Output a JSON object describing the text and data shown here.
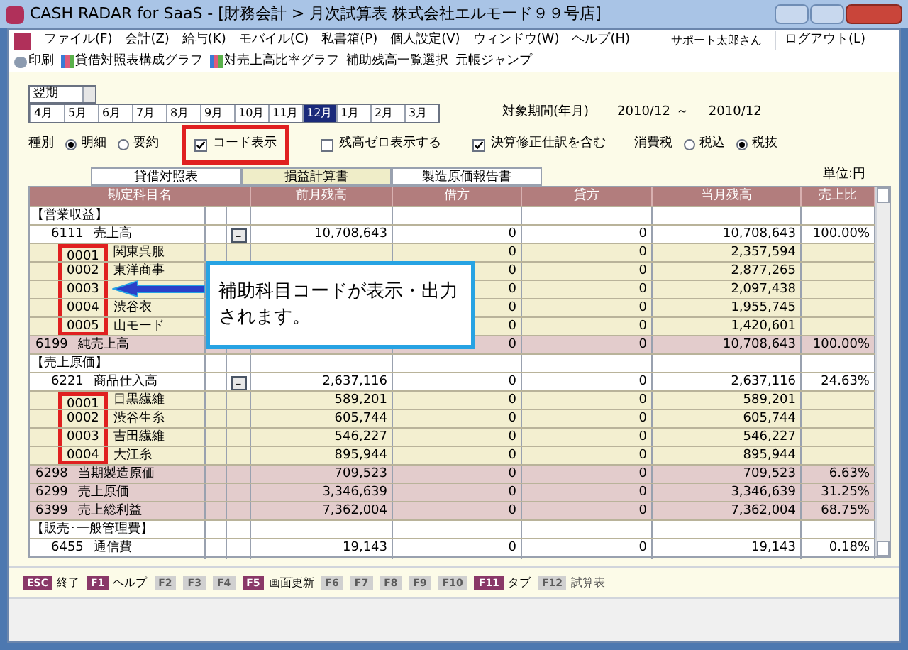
{
  "window": {
    "title": "CASH RADAR for SaaS - [財務会計 > 月次試算表 株式会社エルモード９９号店]"
  },
  "menu": [
    "ファイル(F)",
    "会計(Z)",
    "給与(K)",
    "モバイル(C)",
    "私書箱(P)",
    "個人設定(V)",
    "ウィンドウ(W)",
    "ヘルプ(H)"
  ],
  "user": "サポート太郎さん",
  "logout": "ログアウト(L)",
  "toolbar": [
    {
      "label": "印刷",
      "kind": "print"
    },
    {
      "label": "貸借対照表構成グラフ",
      "kind": "chart"
    },
    {
      "label": "対売上高比率グラフ",
      "kind": "chart"
    },
    {
      "label": "補助残高一覧選択",
      "kind": "text"
    },
    {
      "label": "元帳ジャンプ",
      "kind": "text"
    }
  ],
  "period_select": "翌期",
  "months": [
    {
      "label": "4月",
      "selected": false
    },
    {
      "label": "5月",
      "selected": false
    },
    {
      "label": "6月",
      "selected": false
    },
    {
      "label": "7月",
      "selected": false
    },
    {
      "label": "8月",
      "selected": false
    },
    {
      "label": "9月",
      "selected": false
    },
    {
      "label": "10月",
      "selected": false
    },
    {
      "label": "11月",
      "selected": false
    },
    {
      "label": "12月",
      "selected": true
    },
    {
      "label": "1月",
      "selected": false
    },
    {
      "label": "2月",
      "selected": false
    },
    {
      "label": "3月",
      "selected": false
    }
  ],
  "period_label": "対象期間(年月)",
  "period_from": "2010/12",
  "period_sep": "～",
  "period_to": "2010/12",
  "type_label": "種別",
  "type_options": [
    {
      "label": "明細",
      "selected": true
    },
    {
      "label": "要約",
      "selected": false
    }
  ],
  "checks": [
    {
      "label": "コード表示",
      "checked": true,
      "highlighted": true
    },
    {
      "label": "残高ゼロ表示する",
      "checked": false,
      "highlighted": false
    },
    {
      "label": "決算修正仕訳を含む",
      "checked": true,
      "highlighted": false
    }
  ],
  "tax_label": "消費税",
  "tax_options": [
    {
      "label": "税込",
      "selected": false
    },
    {
      "label": "税抜",
      "selected": true
    }
  ],
  "tabs": [
    {
      "label": "貸借対照表",
      "selected": false
    },
    {
      "label": "損益計算書",
      "selected": true
    },
    {
      "label": "製造原価報告書",
      "selected": false
    }
  ],
  "unit": "単位:円",
  "columns": [
    "勘定科目名",
    "前月残高",
    "借方",
    "貸方",
    "当月残高",
    "売上比"
  ],
  "rows": [
    {
      "kind": "section",
      "name": "【営業収益】"
    },
    {
      "kind": "account",
      "code": "6111",
      "name": "売上高",
      "expand": "－",
      "prior": "10,708,643",
      "debit": "0",
      "credit": "0",
      "current": "10,708,643",
      "ratio": "100.00%"
    },
    {
      "kind": "sub",
      "code": "0001",
      "name": "関東呉服",
      "debit": "0",
      "credit": "0",
      "current": "2,357,594",
      "highlighted": true
    },
    {
      "kind": "sub",
      "code": "0002",
      "name": "東洋商事",
      "debit": "0",
      "credit": "0",
      "current": "2,877,265",
      "highlighted": true
    },
    {
      "kind": "sub",
      "code": "0003",
      "debit": "0",
      "credit": "0",
      "current": "2,097,438",
      "highlighted": true
    },
    {
      "kind": "sub",
      "code": "0004",
      "name": "渋谷衣",
      "debit": "0",
      "credit": "0",
      "current": "1,955,745",
      "highlighted": true
    },
    {
      "kind": "sub",
      "code": "0005",
      "name": "山モード",
      "debit": "0",
      "credit": "0",
      "current": "1,420,601",
      "highlighted": true
    },
    {
      "kind": "total",
      "code": "6199",
      "name": "純売上高",
      "debit": "0",
      "credit": "0",
      "current": "10,708,643",
      "ratio": "100.00%"
    },
    {
      "kind": "section",
      "name": "【売上原価】"
    },
    {
      "kind": "account",
      "code": "6221",
      "name": "商品仕入高",
      "expand": "－",
      "prior": "2,637,116",
      "debit": "0",
      "credit": "0",
      "current": "2,637,116",
      "ratio": "24.63%"
    },
    {
      "kind": "sub",
      "code": "0001",
      "name": "目黒繊維",
      "prior": "589,201",
      "debit": "0",
      "credit": "0",
      "current": "589,201",
      "highlighted": true
    },
    {
      "kind": "sub",
      "code": "0002",
      "name": "渋谷生糸",
      "prior": "605,744",
      "debit": "0",
      "credit": "0",
      "current": "605,744",
      "highlighted": true
    },
    {
      "kind": "sub",
      "code": "0003",
      "name": "吉田繊維",
      "prior": "546,227",
      "debit": "0",
      "credit": "0",
      "current": "546,227",
      "highlighted": true
    },
    {
      "kind": "sub",
      "code": "0004",
      "name": "大江糸",
      "prior": "895,944",
      "debit": "0",
      "credit": "0",
      "current": "895,944",
      "highlighted": true
    },
    {
      "kind": "total",
      "code": "6298",
      "name": "当期製造原価",
      "prior": "709,523",
      "debit": "0",
      "credit": "0",
      "current": "709,523",
      "ratio": "6.63%"
    },
    {
      "kind": "total",
      "code": "6299",
      "name": "売上原価",
      "prior": "3,346,639",
      "debit": "0",
      "credit": "0",
      "current": "3,346,639",
      "ratio": "31.25%"
    },
    {
      "kind": "total",
      "code": "6399",
      "name": "売上総利益",
      "prior": "7,362,004",
      "debit": "0",
      "credit": "0",
      "current": "7,362,004",
      "ratio": "68.75%"
    },
    {
      "kind": "section",
      "name": "【販売･一般管理費】"
    },
    {
      "kind": "account",
      "code": "6455",
      "name": "通信費",
      "prior": "19,143",
      "debit": "0",
      "credit": "0",
      "current": "19,143",
      "ratio": "0.18%"
    }
  ],
  "callout": "補助科目コードが表示・出力されます。",
  "fkeys": [
    {
      "key": "ESC",
      "label": "終了",
      "enabled": true
    },
    {
      "key": "F1",
      "label": "ヘルプ",
      "enabled": true
    },
    {
      "key": "F2",
      "enabled": false
    },
    {
      "key": "F3",
      "enabled": false
    },
    {
      "key": "F4",
      "enabled": false
    },
    {
      "key": "F5",
      "label": "画面更新",
      "enabled": true
    },
    {
      "key": "F6",
      "enabled": false
    },
    {
      "key": "F7",
      "enabled": false
    },
    {
      "key": "F8",
      "enabled": false
    },
    {
      "key": "F9",
      "enabled": false
    },
    {
      "key": "F10",
      "enabled": false
    },
    {
      "key": "F11",
      "label": "タブ",
      "enabled": true
    },
    {
      "key": "F12",
      "label": "試算表",
      "enabled": false
    }
  ]
}
